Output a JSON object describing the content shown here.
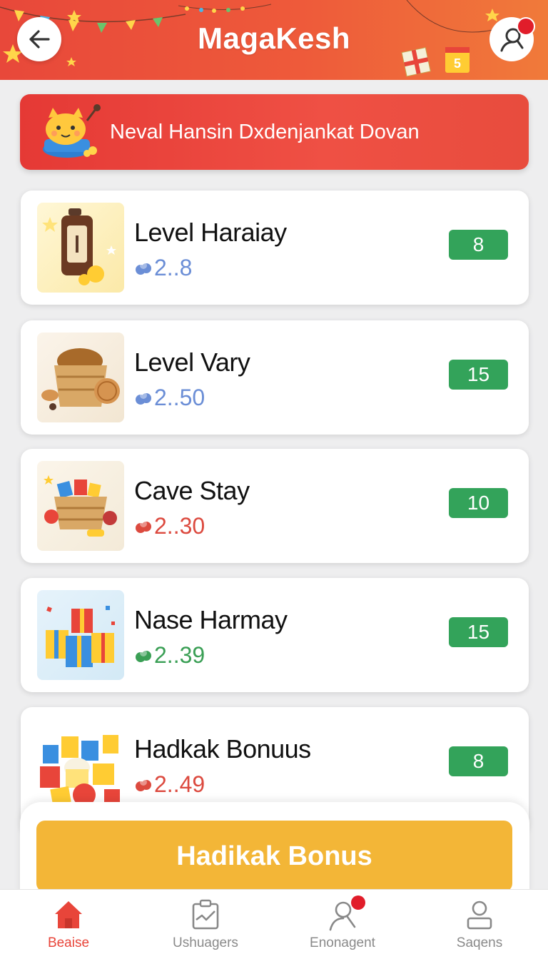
{
  "header": {
    "title": "MagaKesh",
    "back_icon": "arrow-left-icon",
    "profile_icon": "user-search-icon",
    "gift_number": "5"
  },
  "banner": {
    "text": "Neval Hansin Dxdenjankat Dovan",
    "mascot_icon": "mascot-icon"
  },
  "items": [
    {
      "title": "Level Haraiay",
      "price": "2..8",
      "count": "8",
      "price_color": "#6b8ed6"
    },
    {
      "title": "Level Vary",
      "price": "2..50",
      "count": "15",
      "price_color": "#6b8ed6"
    },
    {
      "title": "Cave Stay",
      "price": "2..30",
      "count": "10",
      "price_color": "#dc4a3f"
    },
    {
      "title": "Nase Harmay",
      "price": "2..39",
      "count": "15",
      "price_color": "#3a9f55"
    },
    {
      "title": "Hadkak Bonuus",
      "price": "2..49",
      "count": "8",
      "price_color": "#dc4a3f"
    }
  ],
  "cta": {
    "label": "Hadikak Bonus"
  },
  "nav": [
    {
      "label": "Beaise",
      "icon": "home-icon",
      "active": true
    },
    {
      "label": "Ushuagers",
      "icon": "tasks-icon",
      "active": false
    },
    {
      "label": "Enonagent",
      "icon": "profile-search-icon",
      "active": false
    },
    {
      "label": "Saqens",
      "icon": "account-icon",
      "active": false
    }
  ],
  "colors": {
    "accent": "#e8453a",
    "badge_green": "#33a35a",
    "cta_yellow": "#f3b637"
  }
}
